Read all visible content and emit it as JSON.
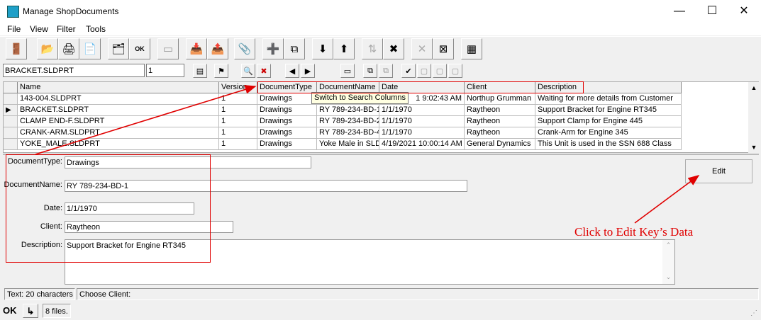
{
  "window": {
    "title": "Manage ShopDocuments",
    "minimize": "—",
    "maximize": "☐",
    "close": "✕"
  },
  "menu": {
    "file": "File",
    "view": "View",
    "filter": "Filter",
    "tools": "Tools"
  },
  "toolbar2": {
    "search_value": "BRACKET.SLDPRT",
    "version_value": "1"
  },
  "grid": {
    "headers": [
      "Name",
      "Version",
      "DocumentType",
      "DocumentName",
      "Date",
      "Client",
      "Description"
    ],
    "rows": [
      [
        "143-004.SLDPRT",
        "1",
        "Drawings",
        "",
        "1 9:02:43 AM",
        "Northup Grumman",
        "Waiting for more details from Customer"
      ],
      [
        "BRACKET.SLDPRT",
        "1",
        "Drawings",
        "RY 789-234-BD-1",
        "1/1/1970",
        "Raytheon",
        "Support Bracket for Engine RT345"
      ],
      [
        "CLAMP END-F.SLDPRT",
        "1",
        "Drawings",
        "RY 789-234-BD-2",
        "1/1/1970",
        "Raytheon",
        "Support Clamp for Engine 445"
      ],
      [
        "CRANK-ARM.SLDPRT",
        "1",
        "Drawings",
        "RY 789-234-BD-4",
        "1/1/1970",
        "Raytheon",
        "Crank-Arm for Engine 345"
      ],
      [
        "YOKE_MALE.SLDPRT",
        "1",
        "Drawings",
        "Yoke Male in SLD",
        "4/19/2021 10:00:14 AM",
        "General Dynamics",
        "This Unit is used in the SSN 688 Class"
      ]
    ],
    "tooltip": "Switch to Search Columns",
    "selected_marker": "▶"
  },
  "detail": {
    "doctype_label": "DocumentType:",
    "doctype_value": "Drawings",
    "docname_label": "DocumentName:",
    "docname_value": "RY 789-234-BD-1",
    "date_label": "Date:",
    "date_value": "1/1/1970",
    "client_label": "Client:",
    "client_value": "Raytheon",
    "desc_label": "Description:",
    "desc_value": "Support Bracket for Engine RT345",
    "edit_label": "Edit"
  },
  "status": {
    "text_info": "Text: 20 characters",
    "hint": "Choose Client:",
    "ok": "OK",
    "arrow": "↳",
    "files": "8 files."
  },
  "annotation": {
    "text": "Click to Edit Key’s Data",
    "color": "#e00000"
  }
}
